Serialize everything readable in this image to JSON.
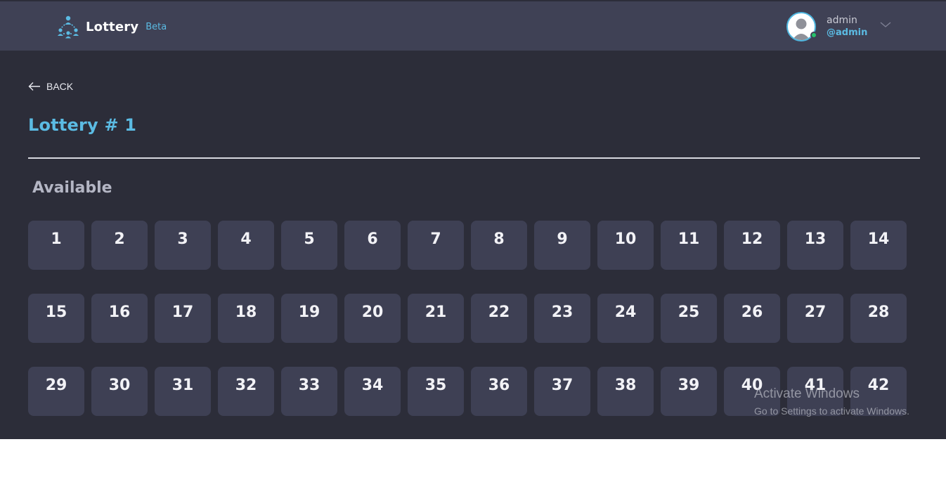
{
  "header": {
    "brand_name": "Lottery",
    "brand_tag": "Beta",
    "logo_icon": "people-network-icon",
    "user": {
      "name": "admin",
      "handle": "@admin",
      "status": "online",
      "status_color": "#27c46b"
    }
  },
  "content": {
    "back_label": "BACK",
    "title": "Lottery # 1",
    "section_title": "Available",
    "numbers": [
      "1",
      "2",
      "3",
      "4",
      "5",
      "6",
      "7",
      "8",
      "9",
      "10",
      "11",
      "12",
      "13",
      "14",
      "15",
      "16",
      "17",
      "18",
      "19",
      "20",
      "21",
      "22",
      "23",
      "24",
      "25",
      "26",
      "27",
      "28",
      "29",
      "30",
      "31",
      "32",
      "33",
      "34",
      "35",
      "36",
      "37",
      "38",
      "39",
      "40",
      "41",
      "42"
    ]
  },
  "watermark": {
    "title": "Activate Windows",
    "subtitle": "Go to Settings to activate Windows."
  },
  "colors": {
    "accent": "#5bbbe3",
    "header_bg": "#3f4155",
    "page_bg": "#2c2d39",
    "tile_bg": "#3e4054"
  }
}
